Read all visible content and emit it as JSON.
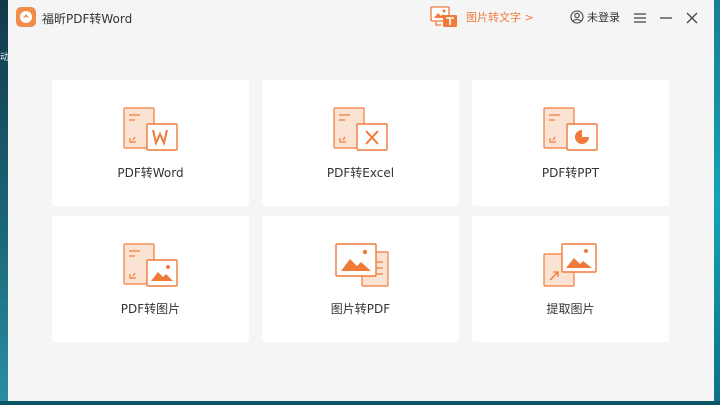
{
  "app": {
    "title": "福昕PDF转Word"
  },
  "header": {
    "ocr_promo": "图片转文字 >",
    "login": "未登录"
  },
  "desktop": {
    "edge_text": "动"
  },
  "cards": [
    {
      "label": "PDF转Word",
      "icon": "pdf-to-word-icon"
    },
    {
      "label": "PDF转Excel",
      "icon": "pdf-to-excel-icon"
    },
    {
      "label": "PDF转PPT",
      "icon": "pdf-to-ppt-icon"
    },
    {
      "label": "PDF转图片",
      "icon": "pdf-to-image-icon"
    },
    {
      "label": "图片转PDF",
      "icon": "image-to-pdf-icon"
    },
    {
      "label": "提取图片",
      "icon": "extract-image-icon"
    }
  ],
  "colors": {
    "accent": "#f07a3a",
    "card_bg": "#ffffff",
    "window_bg": "#f5f5f5"
  }
}
